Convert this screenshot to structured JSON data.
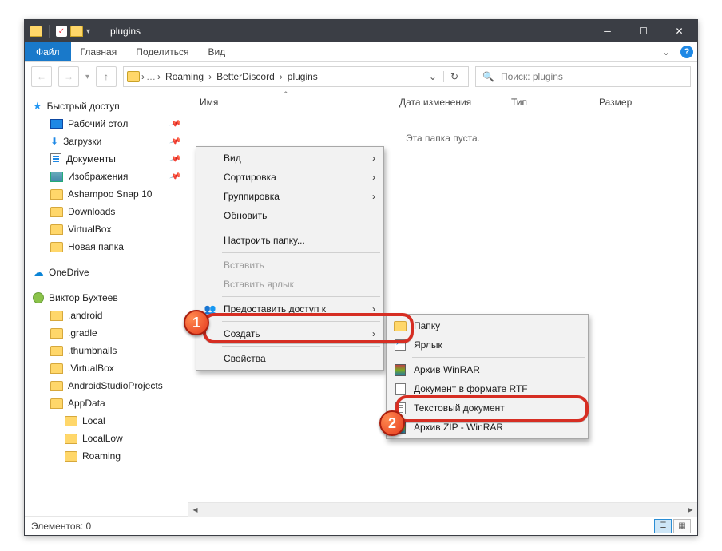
{
  "window": {
    "title": "plugins"
  },
  "ribbon": {
    "file": "Файл",
    "tabs": [
      "Главная",
      "Поделиться",
      "Вид"
    ]
  },
  "breadcrumb": [
    "Roaming",
    "BetterDiscord",
    "plugins"
  ],
  "search": {
    "placeholder": "Поиск: plugins"
  },
  "columns": {
    "name": "Имя",
    "date": "Дата изменения",
    "type": "Тип",
    "size": "Размер"
  },
  "empty_text": "Эта папка пуста.",
  "sidebar": {
    "quick_access": "Быстрый доступ",
    "desktop": "Рабочий стол",
    "downloads": "Загрузки",
    "documents": "Документы",
    "pictures": "Изображения",
    "qa_items": [
      "Ashampoo Snap 10",
      "Downloads",
      "VirtualBox",
      "Новая папка"
    ],
    "onedrive": "OneDrive",
    "user": "Виктор Бухтеев",
    "user_items": [
      ".android",
      ".gradle",
      ".thumbnails",
      ".VirtualBox",
      "AndroidStudioProjects",
      "AppData"
    ],
    "appdata_items": [
      "Local",
      "LocalLow",
      "Roaming"
    ]
  },
  "context_menu": {
    "view": "Вид",
    "sort": "Сортировка",
    "group": "Группировка",
    "refresh": "Обновить",
    "customize": "Настроить папку...",
    "paste": "Вставить",
    "paste_shortcut": "Вставить ярлык",
    "share_access": "Предоставить доступ к",
    "create": "Создать",
    "properties": "Свойства"
  },
  "create_submenu": {
    "folder": "Папку",
    "shortcut": "Ярлык",
    "winrar": "Архив WinRAR",
    "rtf": "Документ в формате RTF",
    "text": "Текстовый документ",
    "zip": "Архив ZIP - WinRAR"
  },
  "status": {
    "elements": "Элементов: 0"
  },
  "badges": {
    "one": "1",
    "two": "2"
  }
}
